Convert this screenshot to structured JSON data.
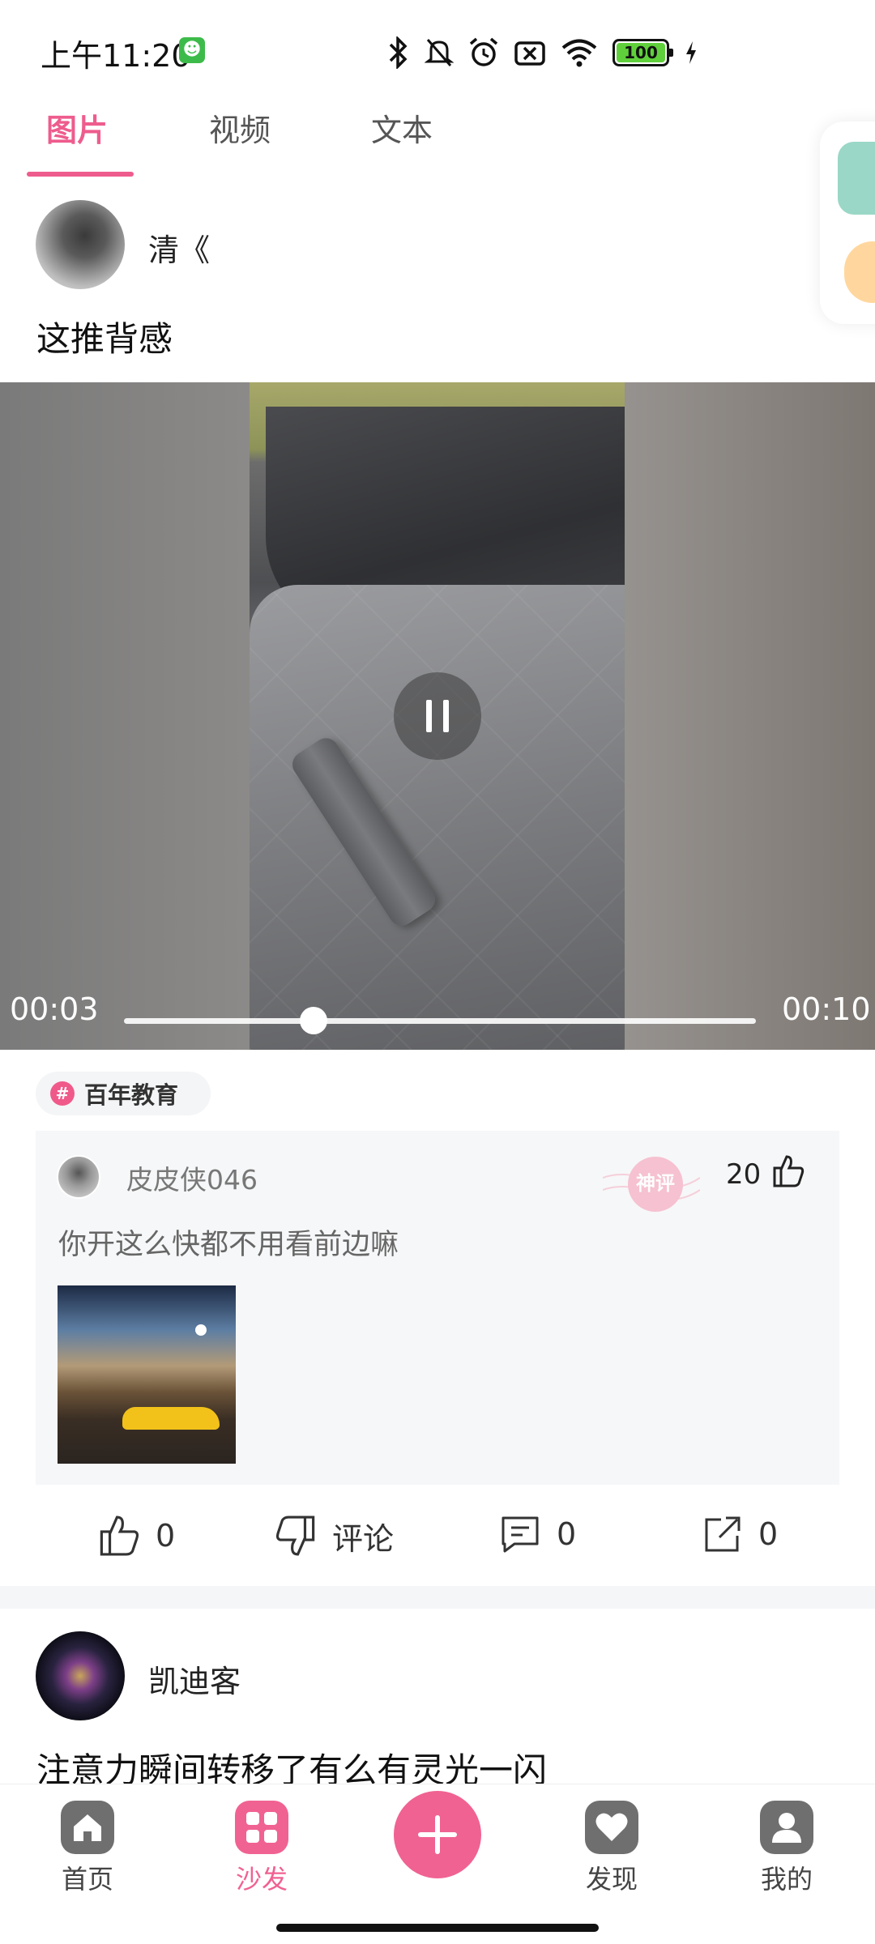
{
  "status_bar": {
    "time": "上午11:20",
    "battery": "100",
    "icons": [
      "android-app-icon",
      "bluetooth-icon",
      "mute-icon",
      "alarm-icon",
      "sim-off-icon",
      "wifi-icon",
      "battery-icon",
      "charging-icon"
    ]
  },
  "tabs": [
    {
      "label": "图片",
      "active": true
    },
    {
      "label": "视频",
      "active": false
    },
    {
      "label": "文本",
      "active": false
    }
  ],
  "post1": {
    "username": "清《",
    "text": "这推背感",
    "video": {
      "current_time": "00:03",
      "total_time": "00:10",
      "progress_fraction": 0.3
    },
    "tag": "百年教育",
    "top_comment": {
      "username": "皮皮侠046",
      "text": "你开这么快都不用看前边嘛",
      "likes": "20",
      "stamp": "神评"
    },
    "actions": {
      "likes": "0",
      "dislike_label": "评论",
      "comments": "0",
      "shares": "0"
    }
  },
  "post2": {
    "username": "凯迪客",
    "text": "注意力瞬间转移了有么有灵光一闪"
  },
  "bottom_nav": [
    {
      "label": "首页",
      "icon": "home-icon",
      "active": false
    },
    {
      "label": "沙发",
      "icon": "grid-icon",
      "active": true
    },
    {
      "label": "发现",
      "icon": "heart-icon",
      "active": false
    },
    {
      "label": "我的",
      "icon": "profile-icon",
      "active": false
    }
  ],
  "colors": {
    "accent": "#f06292",
    "tab_active": "#ee5c8d",
    "text": "#222222"
  }
}
